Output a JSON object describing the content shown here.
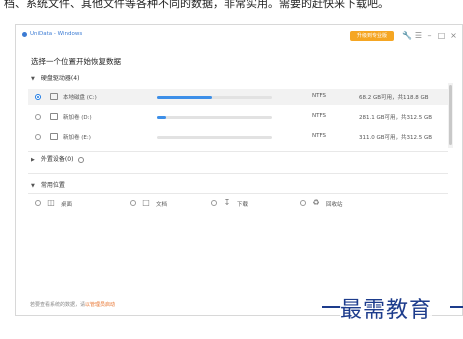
{
  "article": {
    "text": "档、系统文件、其他文件等各种不同的数据，非常实用。需要的赶快来下载吧。"
  },
  "window": {
    "app_title": "UniData - Windows",
    "upgrade_label": "升级到专业版",
    "icons": [
      "wrench-icon",
      "menu-icon",
      "minimize-icon",
      "maximize-icon",
      "close-icon"
    ]
  },
  "main": {
    "heading": "选择一个位置开始恢复数据",
    "drives_section": {
      "title": "硬盘驱动器(4)",
      "drives": [
        {
          "name": "本地磁盘 (C:)",
          "usage": 0.48,
          "fs": "NTFS",
          "space": "68.2 GB可用，共118.8 GB",
          "selected": true
        },
        {
          "name": "新加卷 (D:)",
          "usage": 0.08,
          "fs": "NTFS",
          "space": "281.1 GB可用，共312.5 GB",
          "selected": false
        },
        {
          "name": "新加卷 (E:)",
          "usage": 0.0,
          "fs": "NTFS",
          "space": "311.0 GB可用，共312.5 GB",
          "selected": false
        }
      ]
    },
    "external_section": {
      "title": "外置设备(0)"
    },
    "locations_section": {
      "title": "常用位置",
      "items": [
        {
          "label": "桌面",
          "icon": "desktop-icon"
        },
        {
          "label": "文档",
          "icon": "document-icon"
        },
        {
          "label": "下载",
          "icon": "download-icon"
        },
        {
          "label": "回收站",
          "icon": "trash-icon"
        }
      ]
    },
    "footer": {
      "text": "若要查看系统的数据，请",
      "link": "以管理员启动"
    }
  },
  "watermark": {
    "text": "最需教育"
  },
  "colors": {
    "accent": "#3d8fe8",
    "upgrade": "#f5a623",
    "link": "#e8712a",
    "watermark": "#1d3c8c"
  }
}
